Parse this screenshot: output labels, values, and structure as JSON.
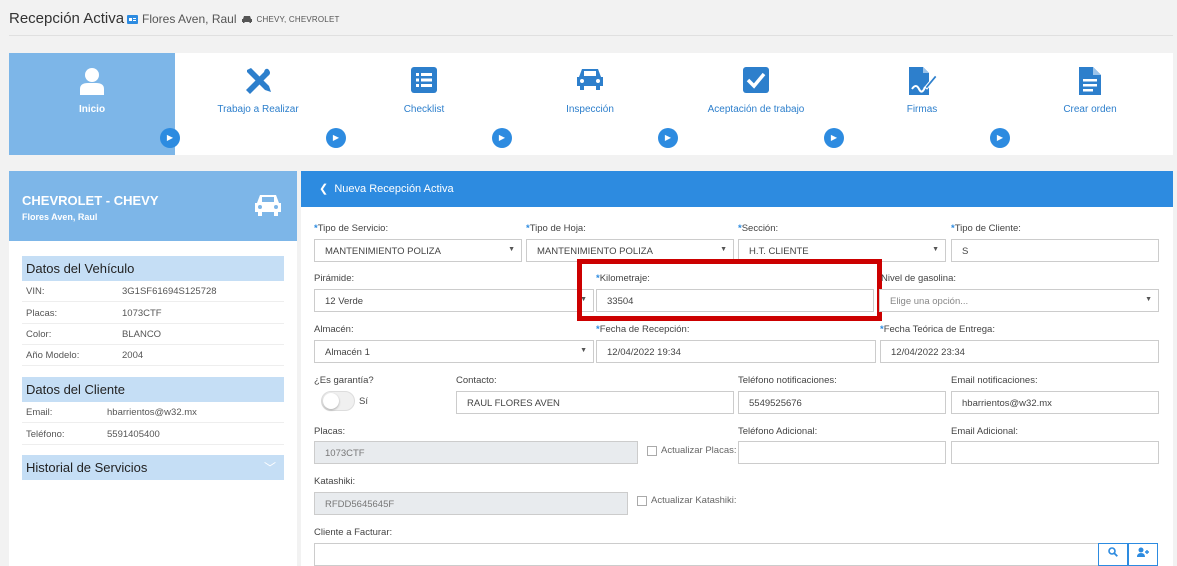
{
  "header": {
    "title": "Recepción Activa",
    "customer": "Flores Aven, Raul",
    "vehicle": "CHEVY, CHEVROLET"
  },
  "steps": [
    {
      "label": "Inicio",
      "icon": "user-icon",
      "active": true
    },
    {
      "label": "Trabajo a Realizar",
      "icon": "tools-icon"
    },
    {
      "label": "Checklist",
      "icon": "checklist-icon"
    },
    {
      "label": "Inspección",
      "icon": "car-icon"
    },
    {
      "label": "Aceptación de trabajo",
      "icon": "checkbox-icon"
    },
    {
      "label": "Firmas",
      "icon": "signature-icon"
    },
    {
      "label": "Crear orden",
      "icon": "document-icon"
    }
  ],
  "vehicle_card": {
    "title": "CHEVROLET - CHEVY",
    "subtitle": "Flores Aven, Raul"
  },
  "datos_vehiculo": {
    "title": "Datos del Vehículo",
    "vin_label": "VIN:",
    "vin": "3G1SF61694S125728",
    "placas_label": "Placas:",
    "placas": "1073CTF",
    "color_label": "Color:",
    "color": "BLANCO",
    "anio_label": "Año Modelo:",
    "anio": "2004"
  },
  "datos_cliente": {
    "title": "Datos del Cliente",
    "email_label": "Email:",
    "email": "hbarrientos@w32.mx",
    "tel_label": "Teléfono:",
    "tel": "5591405400"
  },
  "historial": {
    "title": "Historial de Servicios"
  },
  "form": {
    "title": "Nueva Recepción Activa",
    "tipo_servicio_label": "Tipo de Servicio:",
    "tipo_servicio": "MANTENIMIENTO POLIZA",
    "tipo_hoja_label": "Tipo de Hoja:",
    "tipo_hoja": "MANTENIMIENTO POLIZA",
    "seccion_label": "Sección:",
    "seccion": "H.T. CLIENTE",
    "tipo_cliente_label": "Tipo de Cliente:",
    "tipo_cliente": "S",
    "piramide_label": "Pirámide:",
    "piramide": "12 Verde",
    "kilometraje_label": "Kilometraje:",
    "kilometraje": "33504",
    "gasolina_label": "Nivel de gasolina:",
    "gasolina_placeholder": "Elige una opción...",
    "almacen_label": "Almacén:",
    "almacen": "Almacén 1",
    "fecha_recepcion_label": "Fecha de Recepción:",
    "fecha_recepcion": "12/04/2022 19:34",
    "fecha_entrega_label": "Fecha Teórica de Entrega:",
    "fecha_entrega": "12/04/2022 23:34",
    "garantia_label": "¿Es garantía?",
    "garantia_value": "Sí",
    "contacto_label": "Contacto:",
    "contacto": "RAUL FLORES AVEN",
    "tel_notif_label": "Teléfono notificaciones:",
    "tel_notif": "5549525676",
    "email_notif_label": "Email notificaciones:",
    "email_notif": "hbarrientos@w32.mx",
    "placas_label": "Placas:",
    "placas": "1073CTF",
    "actualizar_placas": "Actualizar Placas:",
    "tel_adicional_label": "Teléfono Adicional:",
    "email_adicional_label": "Email Adicional:",
    "katashiki_label": "Katashiki:",
    "katashiki": "RFDD5645645F",
    "actualizar_katashiki": "Actualizar Katashiki:",
    "cliente_facturar_label": "Cliente a Facturar:"
  },
  "colors": {
    "accent": "#2d8be0",
    "active_step": "#7db6e8",
    "highlight": "#cc0000"
  }
}
